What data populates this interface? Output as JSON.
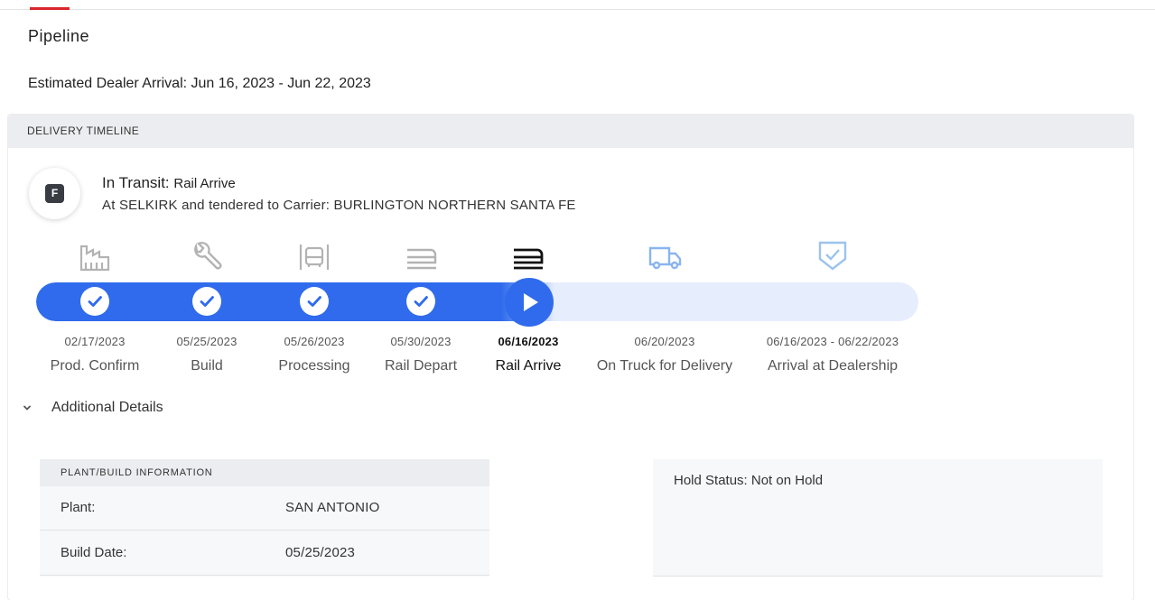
{
  "page": {
    "title": "Pipeline",
    "eta_label": "Estimated Dealer Arrival:",
    "eta_value": "Jun 16, 2023 - Jun 22, 2023"
  },
  "timeline": {
    "header": "DELIVERY TIMELINE",
    "badge_letter": "F",
    "status_main": "In Transit:",
    "status_sub": "Rail Arrive",
    "status_detail": "At SELKIRK and tendered to Carrier: BURLINGTON NORTHERN SANTA FE",
    "accent_color": "#2f6bec",
    "current_step_index": 4,
    "steps": [
      {
        "label": "Prod. Confirm",
        "date": "02/17/2023",
        "state": "complete",
        "icon": "factory-icon"
      },
      {
        "label": "Build",
        "date": "05/25/2023",
        "state": "complete",
        "icon": "wrench-icon"
      },
      {
        "label": "Processing",
        "date": "05/26/2023",
        "state": "complete",
        "icon": "car-processing-icon"
      },
      {
        "label": "Rail Depart",
        "date": "05/30/2023",
        "state": "complete",
        "icon": "rail-icon"
      },
      {
        "label": "Rail Arrive",
        "date": "06/16/2023",
        "state": "current",
        "icon": "rail-icon"
      },
      {
        "label": "On Truck for Delivery",
        "date": "06/20/2023",
        "state": "upcoming",
        "icon": "truck-icon"
      },
      {
        "label": "Arrival at Dealership",
        "date": "06/16/2023 - 06/22/2023",
        "state": "upcoming",
        "icon": "shield-check-icon"
      }
    ]
  },
  "details": {
    "toggle_label": "Additional Details",
    "plant_header": "PLANT/BUILD INFORMATION",
    "plant_rows": [
      {
        "key": "Plant:",
        "value": "SAN ANTONIO"
      },
      {
        "key": "Build Date:",
        "value": "05/25/2023"
      }
    ],
    "hold_status": "Hold Status: Not on Hold"
  }
}
